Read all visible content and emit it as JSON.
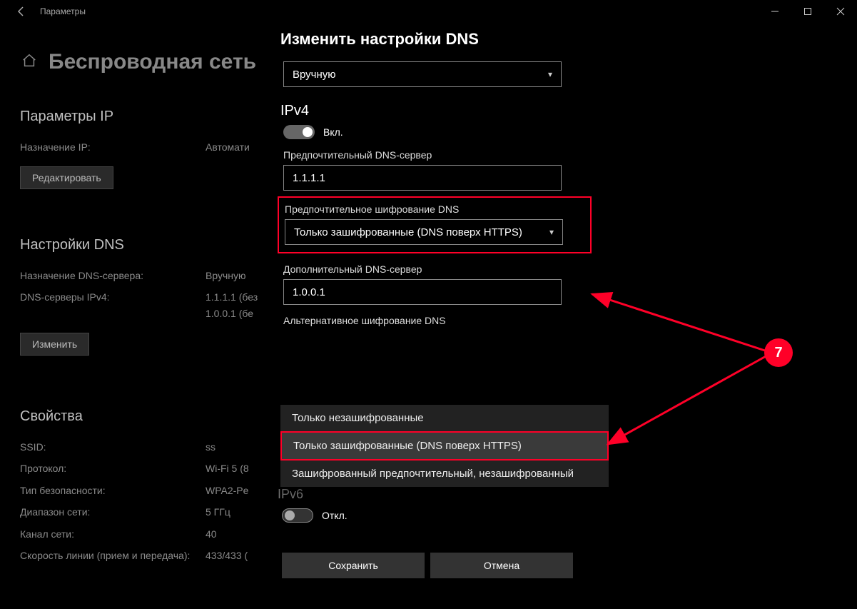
{
  "titlebar": {
    "title": "Параметры"
  },
  "page": {
    "title": "Беспроводная сеть"
  },
  "ip_section": {
    "heading": "Параметры IP",
    "assign_label": "Назначение IP:",
    "assign_value": "Автомати",
    "edit_button": "Редактировать"
  },
  "dns_section": {
    "heading": "Настройки DNS",
    "assign_label": "Назначение DNS-сервера:",
    "assign_value": "Вручную",
    "ipv4_label": "DNS-серверы IPv4:",
    "ipv4_value1": "1.1.1.1 (без",
    "ipv4_value2": "1.0.0.1 (бе",
    "edit_button": "Изменить"
  },
  "props_section": {
    "heading": "Свойства",
    "rows": [
      {
        "label": "SSID:",
        "value": "ss"
      },
      {
        "label": "Протокол:",
        "value": "Wi-Fi 5 (8"
      },
      {
        "label": "Тип безопасности:",
        "value": "WPA2-Pe"
      },
      {
        "label": "Диапазон сети:",
        "value": "5 ГГц"
      },
      {
        "label": "Канал сети:",
        "value": "40"
      },
      {
        "label": "Скорость линии (прием и передача):",
        "value": "433/433 ("
      }
    ]
  },
  "dialog": {
    "title": "Изменить настройки DNS",
    "mode_value": "Вручную",
    "ipv4_heading": "IPv4",
    "toggle_on": "Вкл.",
    "pref_dns_label": "Предпочтительный DNS-сервер",
    "pref_dns_value": "1.1.1.1",
    "pref_enc_label": "Предпочтительное шифрование DNS",
    "pref_enc_value": "Только зашифрованные (DNS поверх HTTPS)",
    "alt_dns_label": "Дополнительный DNS-сервер",
    "alt_dns_value": "1.0.0.1",
    "alt_enc_label": "Альтернативное шифрование DNS",
    "options": [
      "Только незашифрованные",
      "Только зашифрованные (DNS поверх HTTPS)",
      "Зашифрованный предпочтительный, незашифрованный"
    ],
    "ipv6_heading": "IPv6",
    "toggle_off": "Откл.",
    "save": "Сохранить",
    "cancel": "Отмена"
  },
  "annotation": {
    "badge": "7"
  }
}
